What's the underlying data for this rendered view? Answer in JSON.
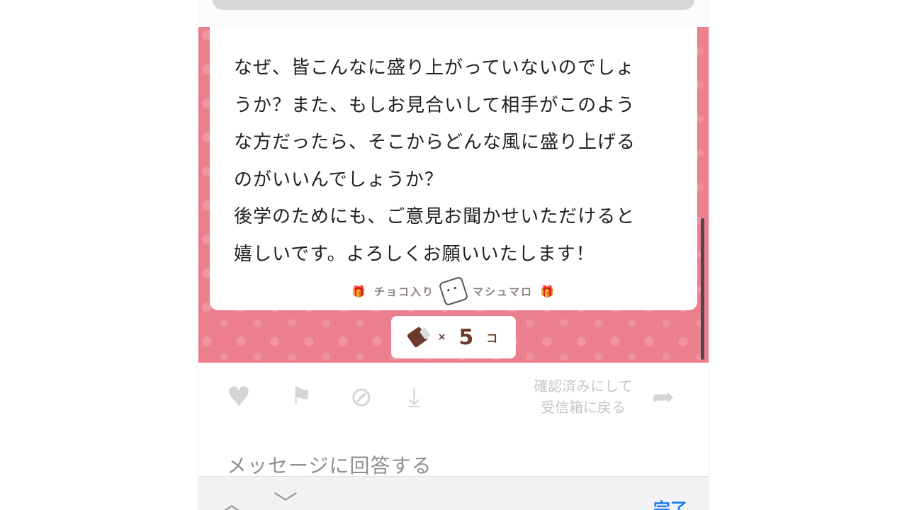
{
  "message": {
    "lines": [
      "なぜ、皆こんなに盛り上がっていないのでしょ",
      "うか？また、もしお見合いして相手がこのよう",
      "な方だったら、そこからどんな風に盛り上げる",
      "のがいいんでしょうか？",
      "後学のためにも、ご意見お聞かせいただけると",
      "嬉しいです。よろしくお願いいたします！"
    ],
    "brand_left": "チョコ入り",
    "brand_right": "マシュマロ"
  },
  "choco_badge": {
    "multiplier": "×",
    "count": "5",
    "unit": "コ"
  },
  "actions": {
    "heart_icon": "heart-icon",
    "flag_icon": "flag-icon",
    "block_icon": "block-icon",
    "download_icon": "download-icon",
    "confirm_line1": "確認済みにして",
    "confirm_line2": "受信箱に戻る",
    "forward_icon": "forward-icon"
  },
  "reply_placeholder": "メッセージに回答する",
  "keyboard_bar": {
    "done_label": "完了"
  },
  "colors": {
    "pink_background": "#ec7f8d",
    "done_blue": "#1e7cf2",
    "chocolate": "#6a3a2c"
  }
}
